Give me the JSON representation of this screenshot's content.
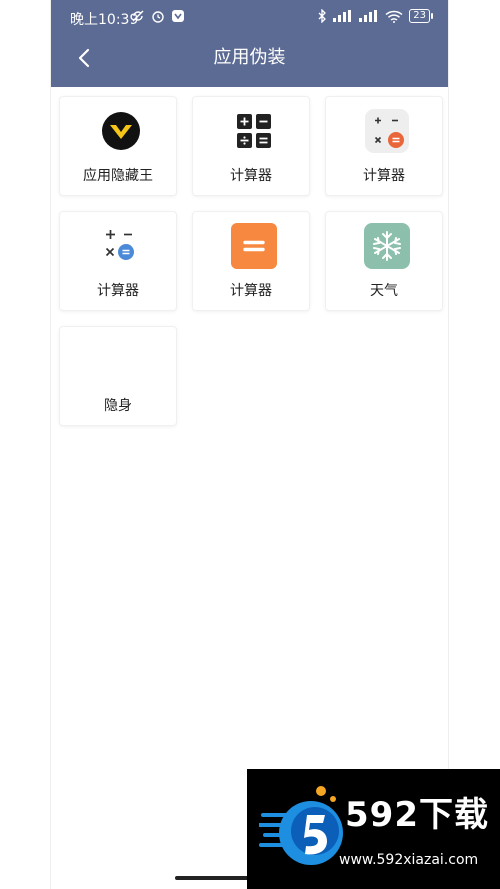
{
  "status_bar": {
    "time": "晚上10:39",
    "battery": "23",
    "icons": [
      "sync-off-icon",
      "alarm-icon",
      "app-shield-icon",
      "bluetooth-icon",
      "signal-icon",
      "signal-icon",
      "wifi-icon"
    ]
  },
  "header": {
    "title": "应用伪装",
    "back_icon": "chevron-left-icon",
    "background": "#5c6b93"
  },
  "apps": [
    {
      "label": "应用隐藏王",
      "icon": "yellow-v-logo-icon"
    },
    {
      "label": "计算器",
      "icon": "calculator-black-keys-icon"
    },
    {
      "label": "计算器",
      "icon": "calculator-orange-equals-icon"
    },
    {
      "label": "计算器",
      "icon": "calculator-blue-equals-icon"
    },
    {
      "label": "计算器",
      "icon": "calculator-orange-tile-icon"
    },
    {
      "label": "天气",
      "icon": "snowflake-icon"
    },
    {
      "label": "隐身",
      "icon": "blank-icon"
    }
  ],
  "watermark": {
    "title": "592下载",
    "url": "www.592xiazai.com"
  }
}
